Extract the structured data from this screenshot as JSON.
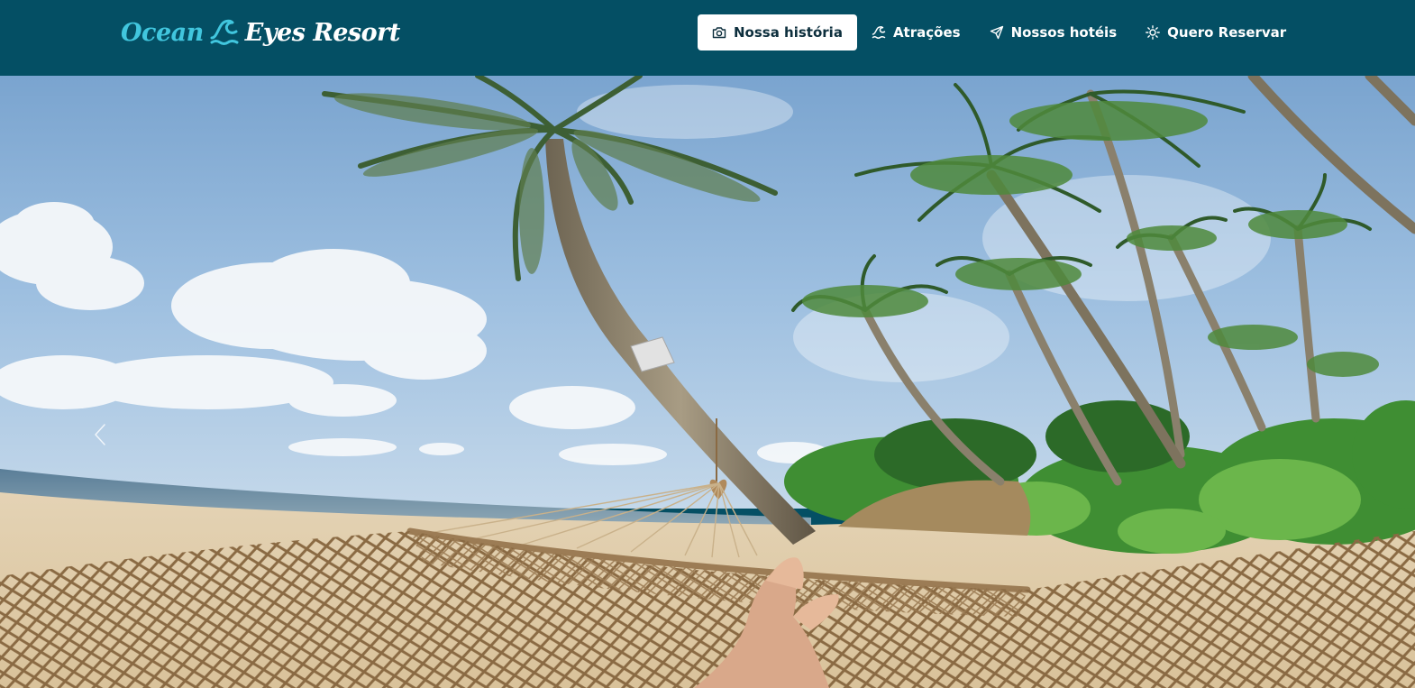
{
  "brand": {
    "part1": "Ocean",
    "part2": "Eyes Resort",
    "icon": "wave-icon"
  },
  "nav": {
    "items": [
      {
        "label": "Nossa história",
        "icon": "camera-icon",
        "active": true
      },
      {
        "label": "Atrações",
        "icon": "wave-icon",
        "active": false
      },
      {
        "label": "Nossos hotéis",
        "icon": "send-icon",
        "active": false
      },
      {
        "label": "Quero Reservar",
        "icon": "sun-icon",
        "active": false
      }
    ]
  },
  "hero": {
    "image": "beach-hammock-palm-trees-photo",
    "carousel_prev_icon": "chevron-left-icon"
  },
  "colors": {
    "header_bg": "#044f64",
    "brand_accent": "#41c6de",
    "nav_active_bg": "#ffffff",
    "nav_active_text": "#0d2f3d",
    "nav_text": "#ffffff"
  }
}
